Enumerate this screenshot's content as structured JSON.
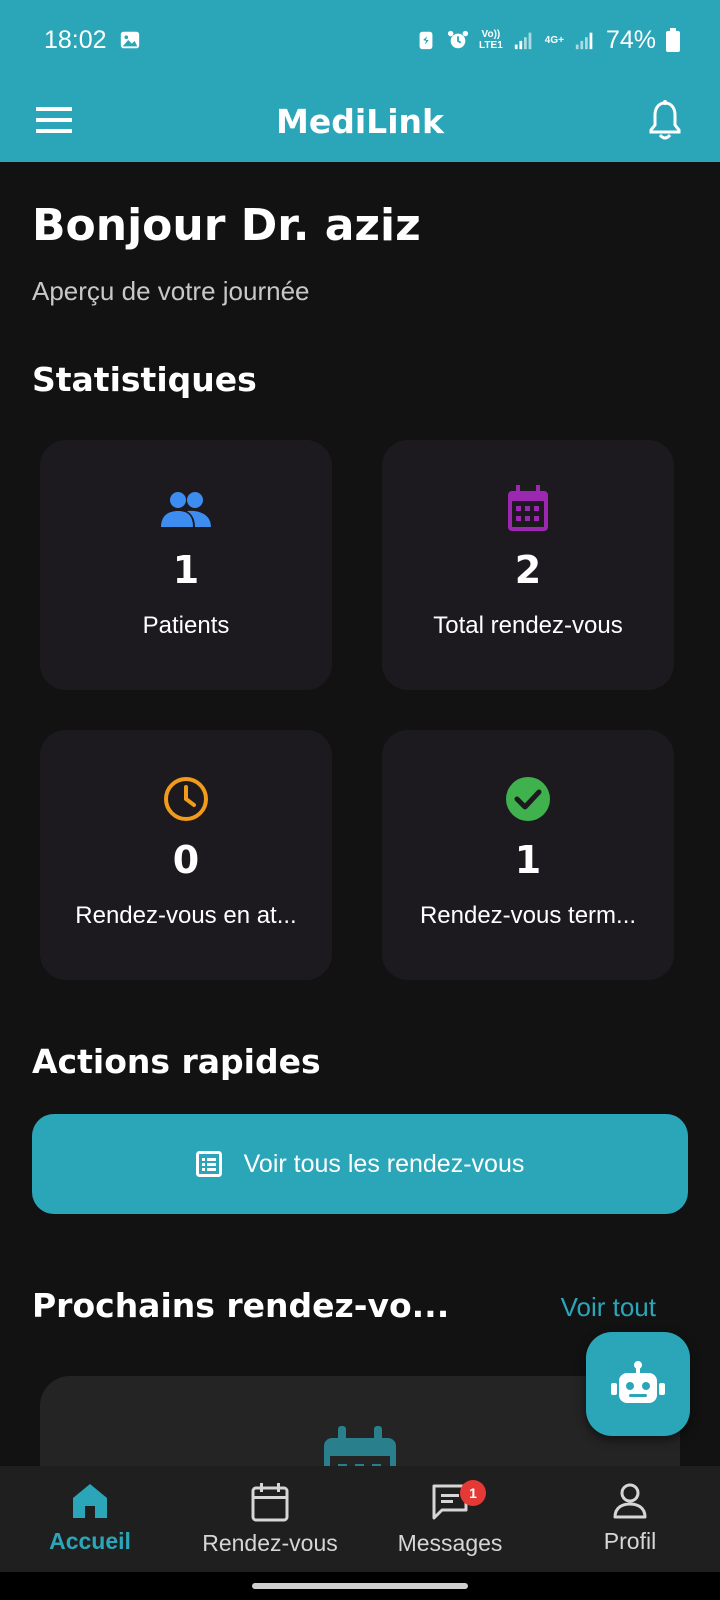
{
  "status_bar": {
    "time": "18:02",
    "net1": "Vo))\nLTE1",
    "net2": "4G+",
    "battery": "74%"
  },
  "app_bar": {
    "title": "MediLink"
  },
  "greeting": {
    "title": "Bonjour Dr. aziz",
    "subtitle": "Aperçu de votre journée"
  },
  "stats": {
    "section_title": "Statistiques",
    "cards": [
      {
        "value": "1",
        "label": "Patients",
        "icon": "people-icon",
        "color": "#3d8df0"
      },
      {
        "value": "2",
        "label": "Total rendez-vous",
        "icon": "calendar-icon",
        "color": "#9c27b0"
      },
      {
        "value": "0",
        "label": "Rendez-vous en at...",
        "icon": "clock-icon",
        "color": "#f29a1a"
      },
      {
        "value": "1",
        "label": "Rendez-vous term...",
        "icon": "check-circle-icon",
        "color": "#3fb24d"
      }
    ]
  },
  "quick_actions": {
    "section_title": "Actions rapides",
    "view_all_appointments": "Voir tous les rendez-vous"
  },
  "upcoming": {
    "section_title": "Prochains rendez-vo...",
    "see_all": "Voir tout"
  },
  "bottom_nav": {
    "items": [
      {
        "label": "Accueil",
        "icon": "home-icon",
        "active": true
      },
      {
        "label": "Rendez-vous",
        "icon": "calendar-icon"
      },
      {
        "label": "Messages",
        "icon": "chat-icon",
        "badge": "1"
      },
      {
        "label": "Profil",
        "icon": "person-icon"
      }
    ]
  },
  "colors": {
    "accent": "#2ba6b9",
    "background": "#121212",
    "card": "#1c1a1e"
  }
}
